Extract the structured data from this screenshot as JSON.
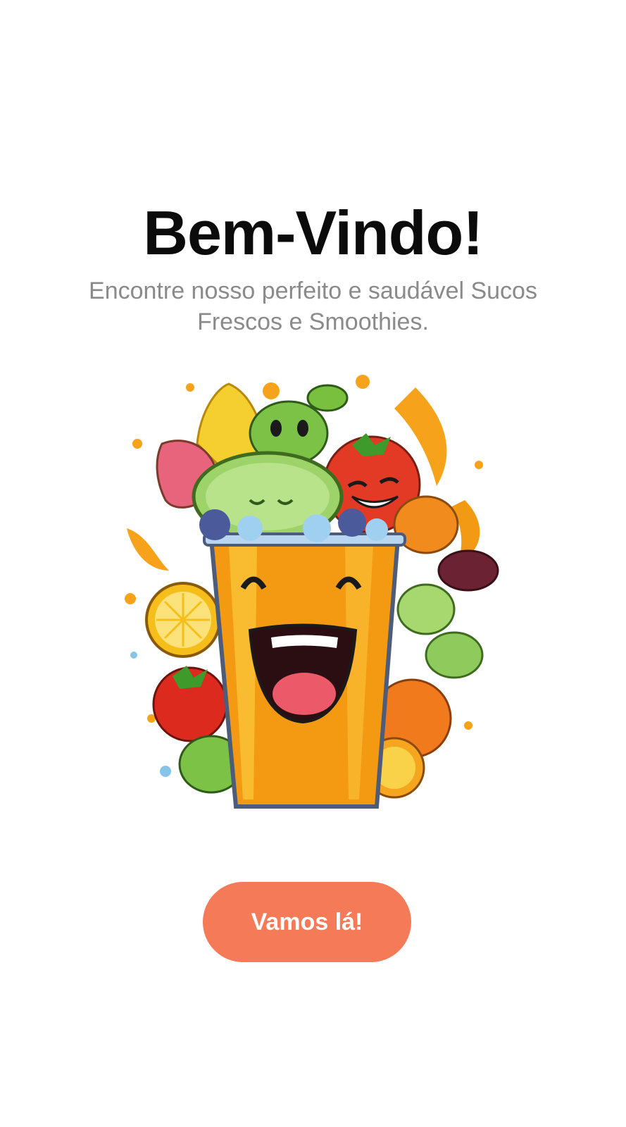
{
  "welcome": {
    "title": "Bem-Vindo!",
    "subtitle": "Encontre nosso perfeito e saudável Sucos Frescos e Smoothies.",
    "illustration": "smiling-juice-cup-with-fruits",
    "cta_label": "Vamos lá!"
  },
  "colors": {
    "background": "#ffffff",
    "title": "#0b0b0b",
    "subtitle": "#8a8a8a",
    "cta_background": "#f47a58",
    "cta_text": "#ffffff"
  }
}
